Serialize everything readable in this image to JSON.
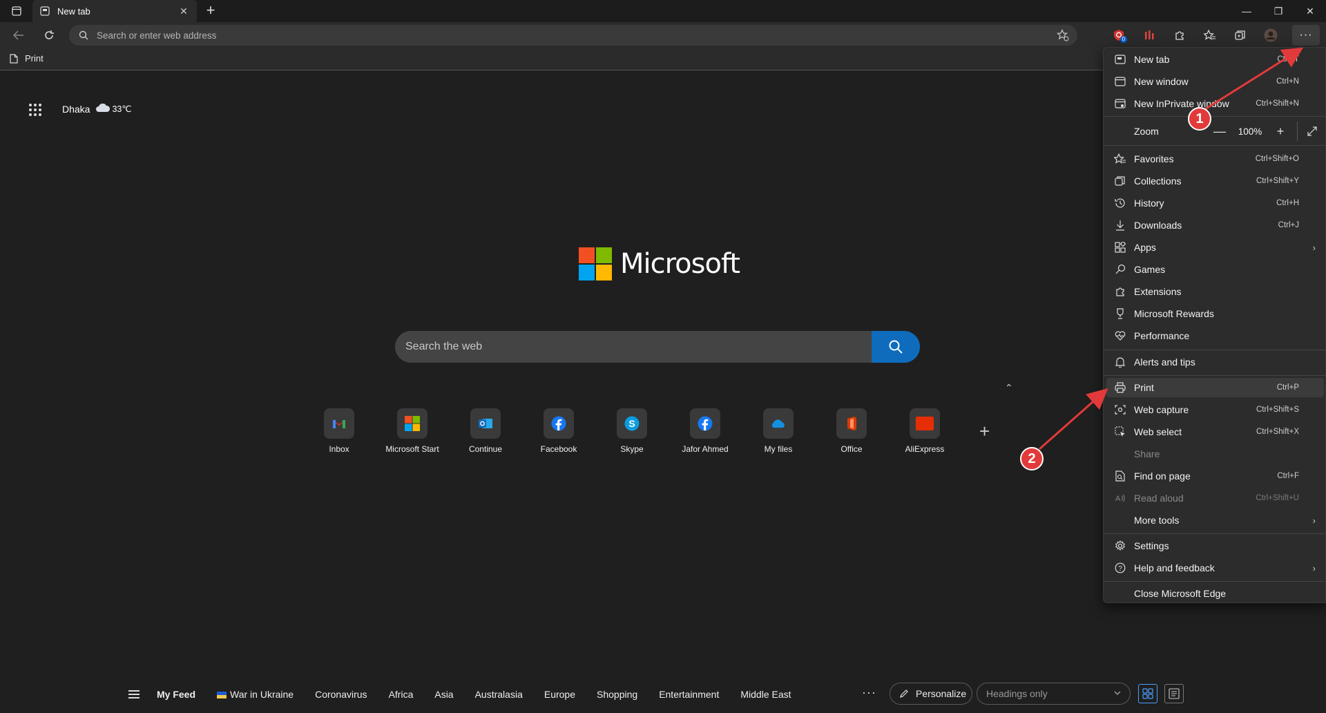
{
  "browser": {
    "tab_title": "New tab",
    "address_placeholder": "Search or enter web address",
    "favorites_bar": [
      {
        "label": "Print",
        "icon": "document-icon"
      }
    ],
    "extensions": [
      "adblock-icon",
      "extension-red-icon",
      "extensions-icon",
      "favorites-star-icon",
      "collections-icon",
      "profile-avatar"
    ],
    "extension_badge": "0"
  },
  "page": {
    "weather": {
      "city": "Dhaka",
      "temp": "33℃"
    },
    "logo_text": "Microsoft",
    "search_placeholder": "Search the web",
    "tiles": [
      {
        "label": "Inbox",
        "icon": "gmail-icon"
      },
      {
        "label": "Microsoft Start",
        "icon": "microsoft-start-icon"
      },
      {
        "label": "Continue",
        "icon": "outlook-icon"
      },
      {
        "label": "Facebook",
        "icon": "facebook-icon"
      },
      {
        "label": "Skype",
        "icon": "skype-icon"
      },
      {
        "label": "Jafor Ahmed",
        "icon": "facebook-icon"
      },
      {
        "label": "My files",
        "icon": "onedrive-icon"
      },
      {
        "label": "Office",
        "icon": "office-icon"
      },
      {
        "label": "AliExpress",
        "icon": "aliexpress-icon"
      }
    ],
    "aliexpress_tile_text": "AliExpress"
  },
  "feed": {
    "tabs": [
      "My Feed",
      "War in Ukraine",
      "Coronavirus",
      "Africa",
      "Asia",
      "Australasia",
      "Europe",
      "Shopping",
      "Entertainment",
      "Middle East"
    ],
    "more": "···",
    "personalize": "Personalize",
    "headings_select": "Headings only"
  },
  "menu": {
    "new_tab": {
      "label": "New tab",
      "shortcut": "Ctrl+T"
    },
    "new_window": {
      "label": "New window",
      "shortcut": "Ctrl+N"
    },
    "new_inprivate": {
      "label": "New InPrivate window",
      "shortcut": "Ctrl+Shift+N"
    },
    "zoom": {
      "label": "Zoom",
      "value": "100%",
      "minus": "—",
      "plus": "+"
    },
    "favorites": {
      "label": "Favorites",
      "shortcut": "Ctrl+Shift+O"
    },
    "collections": {
      "label": "Collections",
      "shortcut": "Ctrl+Shift+Y"
    },
    "history": {
      "label": "History",
      "shortcut": "Ctrl+H"
    },
    "downloads": {
      "label": "Downloads",
      "shortcut": "Ctrl+J"
    },
    "apps": {
      "label": "Apps"
    },
    "games": {
      "label": "Games"
    },
    "extensions": {
      "label": "Extensions"
    },
    "rewards": {
      "label": "Microsoft Rewards"
    },
    "performance": {
      "label": "Performance"
    },
    "alerts": {
      "label": "Alerts and tips"
    },
    "print": {
      "label": "Print",
      "shortcut": "Ctrl+P"
    },
    "web_capture": {
      "label": "Web capture",
      "shortcut": "Ctrl+Shift+S"
    },
    "web_select": {
      "label": "Web select",
      "shortcut": "Ctrl+Shift+X"
    },
    "share": {
      "label": "Share"
    },
    "find": {
      "label": "Find on page",
      "shortcut": "Ctrl+F"
    },
    "read_aloud": {
      "label": "Read aloud",
      "shortcut": "Ctrl+Shift+U"
    },
    "more_tools": {
      "label": "More tools"
    },
    "settings": {
      "label": "Settings"
    },
    "help": {
      "label": "Help and feedback"
    },
    "close_edge": {
      "label": "Close Microsoft Edge"
    }
  },
  "annotations": {
    "marker1": "1",
    "marker2": "2",
    "color": "#e23a3a"
  }
}
